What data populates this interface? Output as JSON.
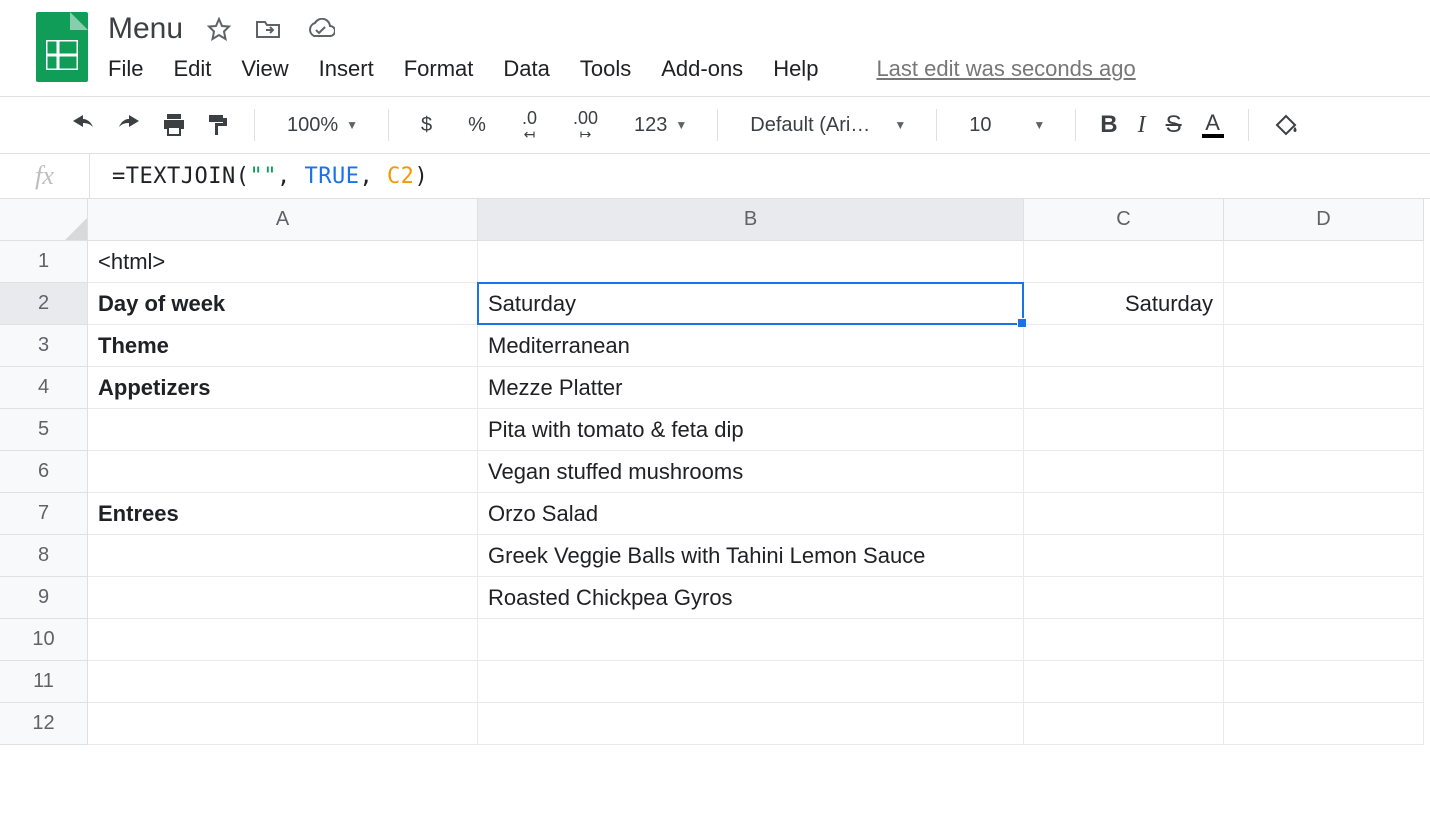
{
  "doc": {
    "title": "Menu"
  },
  "menu": {
    "file": "File",
    "edit": "Edit",
    "view": "View",
    "insert": "Insert",
    "format": "Format",
    "data": "Data",
    "tools": "Tools",
    "addons": "Add-ons",
    "help": "Help",
    "last_edit": "Last edit was seconds ago"
  },
  "toolbar": {
    "zoom": "100%",
    "currency": "$",
    "percent": "%",
    "dec_dec": ".0",
    "inc_dec": ".00",
    "more_fmt": "123",
    "font": "Default (Ari…",
    "size": "10"
  },
  "formula": {
    "prefix": "=TEXTJOIN(",
    "str": "\"\"",
    "comma1": ", ",
    "kw": "TRUE",
    "comma2": ", ",
    "ref": "C2",
    "suffix": ")"
  },
  "columns": [
    "A",
    "B",
    "C",
    "D"
  ],
  "selected_cell": "B2",
  "rows": [
    {
      "n": "1",
      "A": "<html>",
      "B": "",
      "C": "",
      "D": "",
      "boldA": false
    },
    {
      "n": "2",
      "A": "Day of week",
      "B": "Saturday",
      "C": "Saturday",
      "D": "",
      "boldA": true
    },
    {
      "n": "3",
      "A": "Theme",
      "B": "Mediterranean",
      "C": "",
      "D": "",
      "boldA": true
    },
    {
      "n": "4",
      "A": "Appetizers",
      "B": "Mezze Platter",
      "C": "",
      "D": "",
      "boldA": true
    },
    {
      "n": "5",
      "A": "",
      "B": "Pita with tomato & feta dip",
      "C": "",
      "D": "",
      "boldA": false
    },
    {
      "n": "6",
      "A": "",
      "B": "Vegan stuffed mushrooms",
      "C": "",
      "D": "",
      "boldA": false
    },
    {
      "n": "7",
      "A": "Entrees",
      "B": "Orzo Salad",
      "C": "",
      "D": "",
      "boldA": true
    },
    {
      "n": "8",
      "A": "",
      "B": "Greek Veggie Balls with Tahini Lemon Sauce",
      "C": "",
      "D": "",
      "boldA": false
    },
    {
      "n": "9",
      "A": "",
      "B": "Roasted Chickpea Gyros",
      "C": "",
      "D": "",
      "boldA": false
    },
    {
      "n": "10",
      "A": "",
      "B": "",
      "C": "",
      "D": "",
      "boldA": false
    },
    {
      "n": "11",
      "A": "",
      "B": "",
      "C": "",
      "D": "",
      "boldA": false
    },
    {
      "n": "12",
      "A": "",
      "B": "",
      "C": "",
      "D": "",
      "boldA": false
    }
  ]
}
